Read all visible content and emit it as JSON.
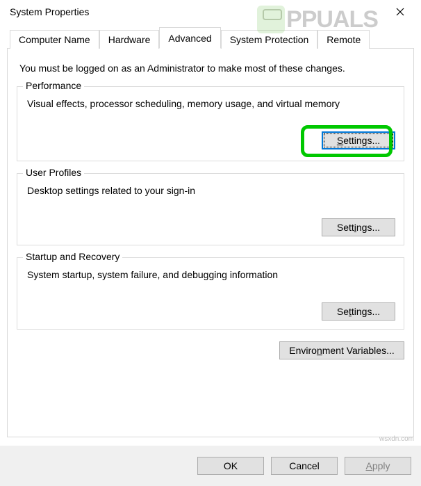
{
  "window": {
    "title": "System Properties"
  },
  "tabs": {
    "computer_name": "Computer Name",
    "hardware": "Hardware",
    "advanced": "Advanced",
    "system_protection": "System Protection",
    "remote": "Remote"
  },
  "intro": "You must be logged on as an Administrator to make most of these changes.",
  "performance": {
    "legend": "Performance",
    "desc": "Visual effects, processor scheduling, memory usage, and virtual memory",
    "button_prefix": "S",
    "button_rest": "ettings..."
  },
  "user_profiles": {
    "legend": "User Profiles",
    "desc": "Desktop settings related to your sign-in",
    "button_pre": "Sett",
    "button_u": "i",
    "button_post": "ngs..."
  },
  "startup": {
    "legend": "Startup and Recovery",
    "desc": "System startup, system failure, and debugging information",
    "button_pre": "Se",
    "button_u": "t",
    "button_post": "tings..."
  },
  "env": {
    "button_pre": "Enviro",
    "button_u": "n",
    "button_post": "ment Variables..."
  },
  "footer": {
    "ok": "OK",
    "cancel": "Cancel",
    "apply_u": "A",
    "apply_rest": "pply"
  },
  "watermark": {
    "text": "PPUALS"
  },
  "bottom_url": "wsxdn.com"
}
